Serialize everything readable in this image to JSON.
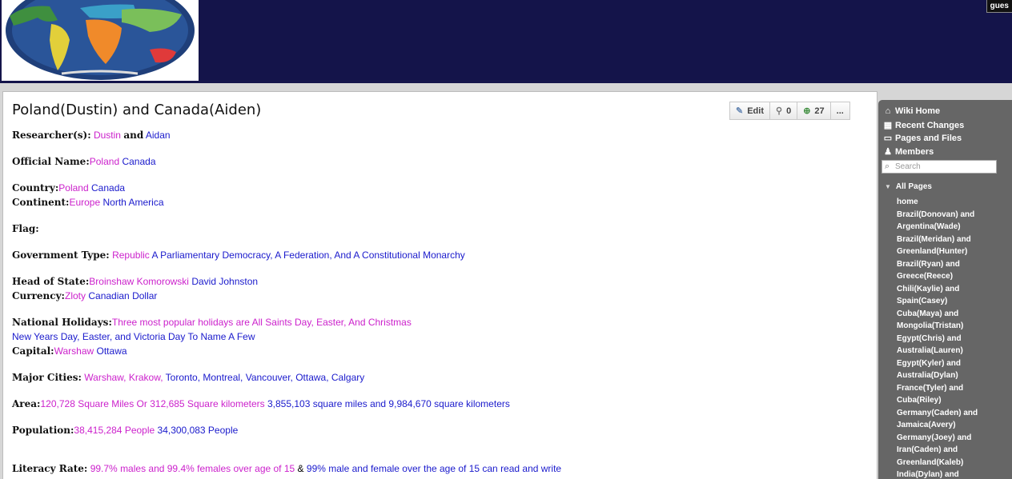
{
  "header": {
    "guest": "gues"
  },
  "page": {
    "title": "Poland(Dustin) and Canada(Aiden)",
    "toolbar": {
      "edit": "Edit",
      "links_count": "0",
      "follow_count": "27",
      "more": "..."
    }
  },
  "fields": {
    "researchers": {
      "label": "Researcher(s):",
      "a": "Dustin",
      "and": "and",
      "b": "Aidan"
    },
    "official_name": {
      "label": "Official Name:",
      "a": "Poland",
      "b": "Canada"
    },
    "country": {
      "label": "Country:",
      "a": "Poland",
      "b": "Canada"
    },
    "continent": {
      "label": "Continent:",
      "a": "Europe",
      "b": "North America"
    },
    "flag": {
      "label": "Flag:"
    },
    "government": {
      "label": "Government Type:",
      "a": "Republic",
      "b": "A Parliamentary Democracy, A Federation, And A Constitutional Monarchy"
    },
    "head_of_state": {
      "label": "Head of State:",
      "a": "Broinshaw Komorowski",
      "b": "David Johnston"
    },
    "currency": {
      "label": "Currency:",
      "a": "Zloty",
      "b": "Canadian Dollar"
    },
    "holidays": {
      "label": "National Holidays:",
      "a": "Three most popular holidays are All Saints Day, Easter, And Christmas",
      "b": "New Years Day, Easter, and Victoria Day To Name A Few"
    },
    "capital": {
      "label": "Capital:",
      "a": "Warshaw",
      "b": "Ottawa"
    },
    "major_cities": {
      "label": "Major Cities:",
      "a": "Warshaw, Krakow,",
      "b": "Toronto, Montreal, Vancouver, Ottawa, Calgary"
    },
    "area": {
      "label": "Area:",
      "a": "120,728 Square Miles Or 312,685 Square kilometers",
      "b": "3,855,103 square miles and 9,984,670 square kilometers"
    },
    "population": {
      "label": "Population:",
      "a": "38,415,284 People",
      "b": "34,300,083 People"
    },
    "literacy": {
      "label": "Literacy Rate:",
      "a": "99.7% males and 99.4% females over age of 15",
      "amp": "&",
      "b": "99% male and female over the age of 15 can read and write"
    }
  },
  "sidebar": {
    "nav": [
      {
        "label": "Wiki Home",
        "icon": "home-icon"
      },
      {
        "label": "Recent Changes",
        "icon": "calendar-icon"
      },
      {
        "label": "Pages and Files",
        "icon": "folder-icon"
      },
      {
        "label": "Members",
        "icon": "members-icon"
      }
    ],
    "search_placeholder": "Search",
    "all_pages": "All Pages",
    "pages": [
      "home",
      "Brazil(Donovan) and",
      "Argentina(Wade)",
      "Brazil(Meridan) and",
      "Greenland(Hunter)",
      "Brazil(Ryan) and",
      "Greece(Reece)",
      "Chili(Kaylie) and",
      "Spain(Casey)",
      "Cuba(Maya) and",
      "Mongolia(Tristan)",
      "Egypt(Chris) and",
      "Australia(Lauren)",
      "Egypt(Kyler) and",
      "Australia(Dylan)",
      "France(Tyler) and",
      "Cuba(Riley)",
      "Germany(Caden) and",
      "Jamaica(Avery)",
      "Germany(Joey) and",
      "Iran(Caden) and",
      "Greenland(Kaleb)",
      "India(Dylan) and"
    ]
  },
  "colors": {
    "header": "#14144a",
    "country_a": "#cc22cc",
    "country_b": "#1a1acc",
    "sidebar": "#666666"
  }
}
